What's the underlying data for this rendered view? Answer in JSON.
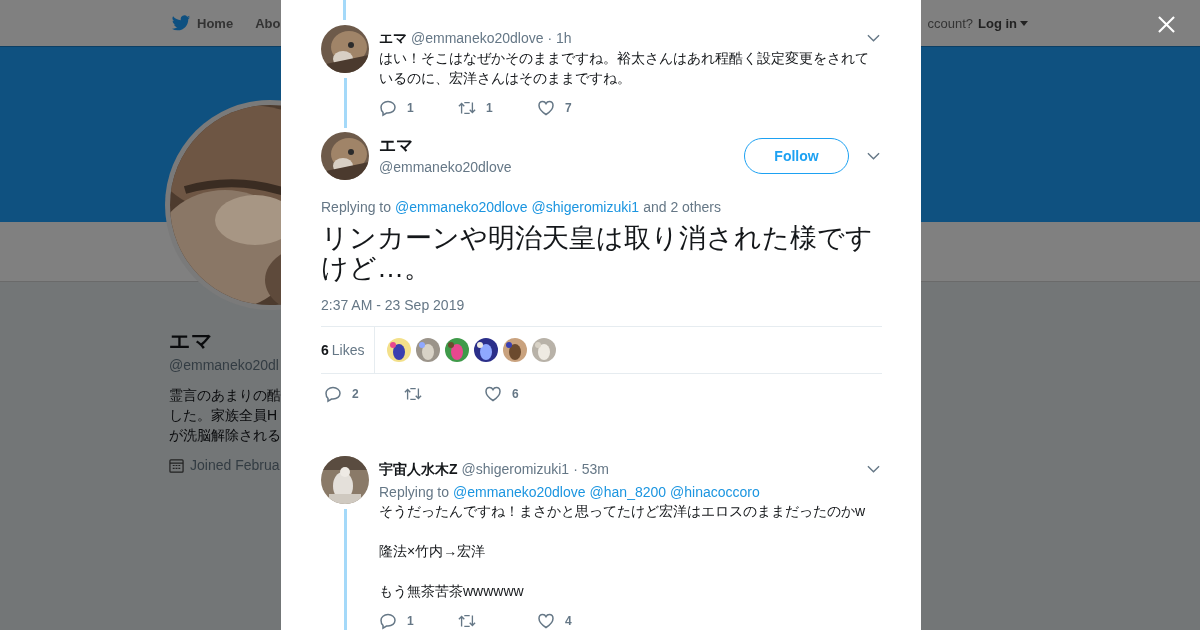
{
  "page_nav": {
    "home": "Home",
    "about": "Abo",
    "account_prompt": "ccount?",
    "login": "Log in"
  },
  "profile": {
    "name": "エマ",
    "handle": "@emmaneko20dl",
    "bio_lines": [
      "霊言のあまりの酷",
      "した。家族全員H",
      "が洗脳解除される"
    ],
    "joined": "Joined Februa"
  },
  "thread": {
    "parent": {
      "name": "エマ",
      "handle": "@emmaneko20dlove",
      "time": "· 1h",
      "text": "はい！そこはなぜかそのままですね。裕太さんはあれ程酷く設定変更をされているのに、宏洋さんはそのままですね。",
      "replies": "1",
      "retweets": "1",
      "likes": "7"
    },
    "main": {
      "name": "エマ",
      "handle": "@emmaneko20dlove",
      "follow": "Follow",
      "replying_label": "Replying to",
      "mentions": [
        "@emmaneko20dlove",
        "@shigeromizuki1"
      ],
      "others": "and 2 others",
      "text": "リンカーンや明治天皇は取り消された様ですけど…。",
      "timestamp": "2:37 AM - 23 Sep 2019",
      "likes_count": "6",
      "likes_label": "Likes",
      "likers": [
        {
          "kind": "picture"
        },
        {
          "kind": "picture"
        },
        {
          "kind": "picture"
        },
        {
          "kind": "picture"
        },
        {
          "kind": "picture"
        },
        {
          "kind": "picture"
        }
      ],
      "replies": "2",
      "likes": "6"
    },
    "reply": {
      "name": "宇宙人水木Z",
      "handle": "@shigeromizuki1",
      "time": "· 53m",
      "replying_label": "Replying to",
      "mentions": [
        "@emmaneko20dlove",
        "@han_8200",
        "@hinacoccoro"
      ],
      "paragraphs": [
        "そうだったんですね！まさかと思ってたけど宏洋はエロスのままだったのかw",
        "隆法×竹内→宏洋",
        "もう無茶苦茶wwwwww"
      ],
      "replies": "1",
      "likes": "4"
    }
  }
}
